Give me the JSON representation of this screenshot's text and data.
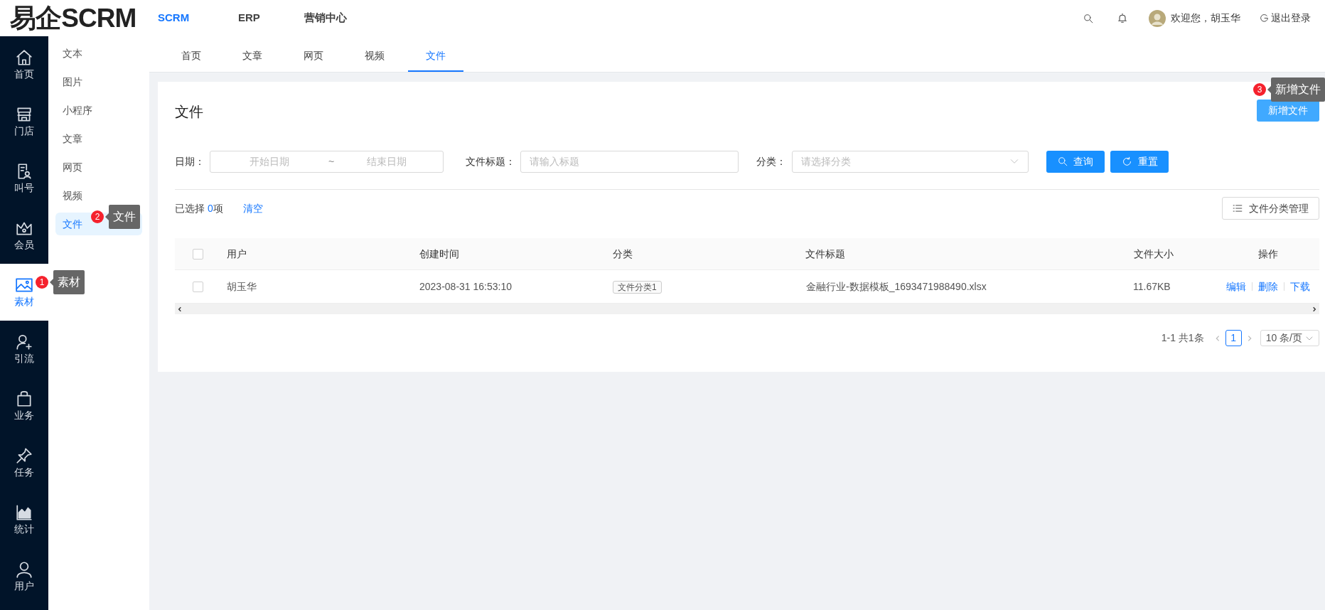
{
  "logo": "易企SCRM",
  "top_nav": [
    {
      "label": "SCRM",
      "selected": true
    },
    {
      "label": "ERP",
      "selected": false
    },
    {
      "label": "营销中心",
      "selected": false
    }
  ],
  "header": {
    "welcome": "欢迎您，胡玉华",
    "logout": "退出登录"
  },
  "rail": [
    {
      "label": "首页",
      "selected": false
    },
    {
      "label": "门店",
      "selected": false
    },
    {
      "label": "叫号",
      "selected": false
    },
    {
      "label": "会员",
      "selected": false
    },
    {
      "label": "素材",
      "selected": true
    },
    {
      "label": "引流",
      "selected": false
    },
    {
      "label": "业务",
      "selected": false
    },
    {
      "label": "任务",
      "selected": false
    },
    {
      "label": "统计",
      "selected": false
    },
    {
      "label": "用户",
      "selected": false
    }
  ],
  "submenu": [
    {
      "label": "文本",
      "selected": false
    },
    {
      "label": "图片",
      "selected": false
    },
    {
      "label": "小程序",
      "selected": false
    },
    {
      "label": "文章",
      "selected": false
    },
    {
      "label": "网页",
      "selected": false
    },
    {
      "label": "视频",
      "selected": false
    },
    {
      "label": "文件",
      "selected": true
    }
  ],
  "tabs": [
    {
      "label": "首页",
      "selected": false
    },
    {
      "label": "文章",
      "selected": false
    },
    {
      "label": "网页",
      "selected": false
    },
    {
      "label": "视频",
      "selected": false
    },
    {
      "label": "文件",
      "selected": true
    }
  ],
  "page_title": "文件",
  "add_button": "新增文件",
  "filters": {
    "date_label": "日期：",
    "start_placeholder": "开始日期",
    "separator": "~",
    "end_placeholder": "结束日期",
    "title_label": "文件标题：",
    "title_placeholder": "请输入标题",
    "category_label": "分类：",
    "category_placeholder": "请选择分类"
  },
  "search_button": "查询",
  "reset_button": "重置",
  "selection": {
    "prefix": "已选择",
    "count": "0",
    "suffix": "项",
    "clear": "清空"
  },
  "category_manage_button": "文件分类管理",
  "table": {
    "select_all_checked": false,
    "columns": [
      "用户",
      "创建时间",
      "分类",
      "文件标题",
      "文件大小",
      "操作"
    ],
    "rows": [
      {
        "checked": false,
        "user": "胡玉华",
        "created": "2023-08-31 16:53:10",
        "category": "文件分类1",
        "title": "金融行业-数据模板_1693471988490.xlsx",
        "size": "11.67KB",
        "actions": [
          "编辑",
          "删除",
          "下载"
        ]
      }
    ]
  },
  "pagination": {
    "summary": "1-1 共1条",
    "pages": [
      {
        "label": "1",
        "selected": true
      }
    ],
    "page_size": "10 条/页"
  },
  "callouts": [
    {
      "number": "1",
      "text": "素材"
    },
    {
      "number": "2",
      "text": "文件"
    },
    {
      "number": "3",
      "text": "新增文件"
    }
  ]
}
